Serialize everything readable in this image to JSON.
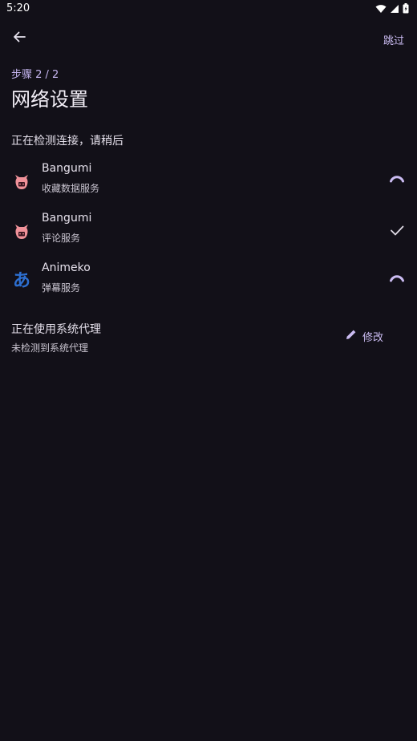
{
  "status_bar": {
    "time": "5:20",
    "icons": [
      "wifi-icon",
      "signal-icon",
      "battery-icon"
    ]
  },
  "header": {
    "back_icon": "arrow-left-icon",
    "skip_label": "跳过"
  },
  "step": "步骤 2 / 2",
  "title": "网络设置",
  "section_title": "正在检测连接，请稍后",
  "services": [
    {
      "name": "Bangumi",
      "desc": "收藏数据服务",
      "icon": "bangumi-icon",
      "status": "loading"
    },
    {
      "name": "Bangumi",
      "desc": "评论服务",
      "icon": "bangumi-icon",
      "status": "done"
    },
    {
      "name": "Animeko",
      "desc": "弹幕服务",
      "icon": "animeko-icon",
      "icon_glyph": "あ",
      "status": "loading"
    }
  ],
  "proxy": {
    "title": "正在使用系统代理",
    "desc": "未检测到系统代理",
    "edit_label": "修改",
    "edit_icon": "pencil-icon"
  },
  "colors": {
    "background": "#121018",
    "accent": "#cbbcf2",
    "bangumi_pink": "#f09199",
    "animeko_blue": "#2d6fd0"
  }
}
